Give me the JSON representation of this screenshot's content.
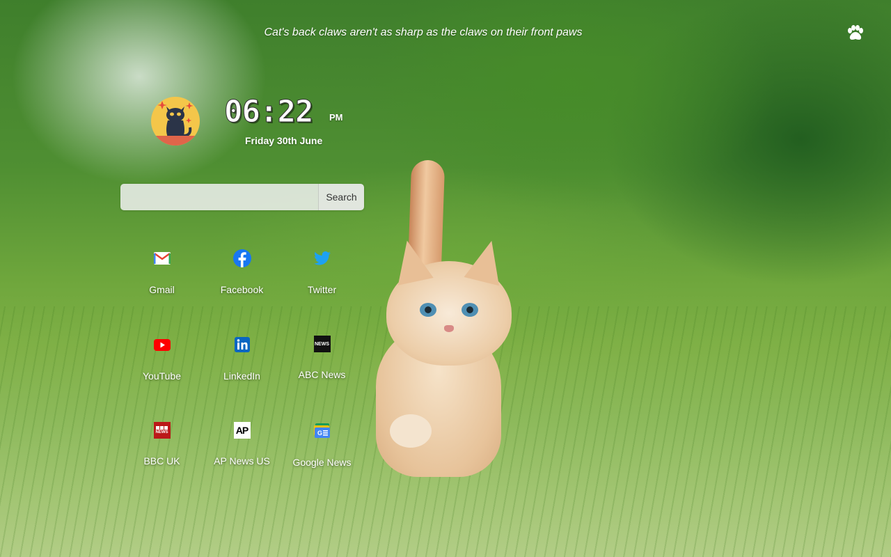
{
  "fact": "Cat's back claws aren't as sharp as the claws on their front paws",
  "menu_icon": "paw-icon",
  "avatar_icon": "black-cat-icon",
  "clock": {
    "time": "06:22",
    "ampm": "PM",
    "date": "Friday 30th June"
  },
  "search": {
    "placeholder": "",
    "value": "",
    "button_label": "Search"
  },
  "shortcuts": [
    {
      "label": "Gmail",
      "icon": "gmail-icon"
    },
    {
      "label": "Facebook",
      "icon": "facebook-icon"
    },
    {
      "label": "Twitter",
      "icon": "twitter-icon"
    },
    {
      "label": "YouTube",
      "icon": "youtube-icon"
    },
    {
      "label": "LinkedIn",
      "icon": "linkedin-icon"
    },
    {
      "label": "ABC News",
      "icon": "abc-news-icon",
      "icon_text": "NEWS"
    },
    {
      "label": "BBC UK",
      "icon": "bbc-news-icon",
      "icon_text": "NEWS"
    },
    {
      "label": "AP News US",
      "icon": "ap-news-icon",
      "icon_text": "AP"
    },
    {
      "label": "Google News",
      "icon": "google-news-icon"
    }
  ],
  "colors": {
    "facebook": "#1877f2",
    "twitter": "#1da1f2",
    "youtube": "#ff0000",
    "linkedin": "#0a66c2",
    "bbc": "#bb1919",
    "avatar_bg": "#f4c64a"
  }
}
